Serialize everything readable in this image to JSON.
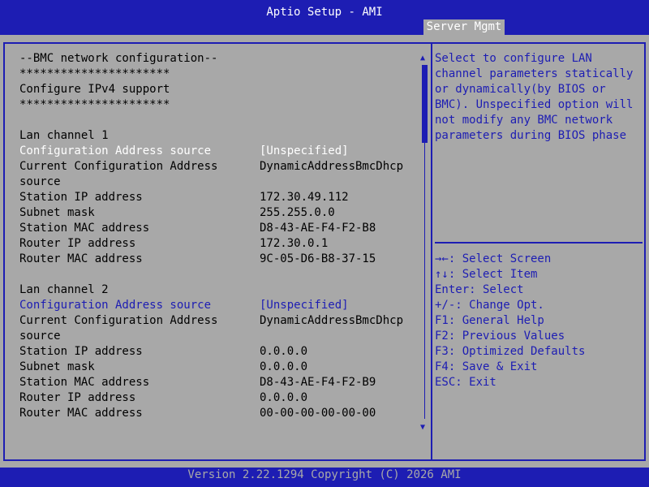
{
  "header": {
    "title": "Aptio Setup - AMI",
    "tab": "Server Mgmt"
  },
  "main": {
    "lines": [
      "--BMC network configuration--",
      "**********************",
      "Configure IPv4 support",
      "**********************",
      "Lan channel 1"
    ],
    "ch1": {
      "config_label": "Configuration Address source",
      "config_value": "[Unspecified]",
      "current_label_1": "Current Configuration Address",
      "current_label_2": "source",
      "current_value": "DynamicAddressBmcDhcp",
      "station_ip_label": "Station IP address",
      "station_ip_value": "172.30.49.112",
      "subnet_label": "Subnet mask",
      "subnet_value": "255.255.0.0",
      "station_mac_label": "Station MAC address",
      "station_mac_value": "D8-43-AE-F4-F2-B8",
      "router_ip_label": "Router IP address",
      "router_ip_value": "172.30.0.1",
      "router_mac_label": "Router MAC address",
      "router_mac_value": "9C-05-D6-B8-37-15"
    },
    "ch2_title": "Lan channel 2",
    "ch2": {
      "config_label": "Configuration Address source",
      "config_value": "[Unspecified]",
      "current_label_1": "Current Configuration Address",
      "current_label_2": "source",
      "current_value": "DynamicAddressBmcDhcp",
      "station_ip_label": "Station IP address",
      "station_ip_value": "0.0.0.0",
      "subnet_label": "Subnet mask",
      "subnet_value": "0.0.0.0",
      "station_mac_label": "Station MAC address",
      "station_mac_value": "D8-43-AE-F4-F2-B9",
      "router_ip_label": "Router IP address",
      "router_ip_value": "0.0.0.0",
      "router_mac_label": "Router MAC address",
      "router_mac_value": "00-00-00-00-00-00"
    }
  },
  "help": {
    "description": [
      "Select to configure LAN",
      "channel parameters statically",
      "or dynamically(by BIOS or",
      "BMC). Unspecified option will",
      "not modify any BMC network",
      "parameters during BIOS phase"
    ],
    "keys": [
      "→←: Select Screen",
      "↑↓: Select Item",
      "Enter: Select",
      "+/-: Change Opt.",
      "F1: General Help",
      "F2: Previous Values",
      "F3: Optimized Defaults",
      "F4: Save & Exit",
      "ESC: Exit"
    ]
  },
  "scroll": {
    "up_icon": "▲",
    "down_icon": "▼"
  },
  "footer": {
    "text": "Version 2.22.1294 Copyright (C) 2026 AMI"
  },
  "colors": {
    "background": "#a8a8a8",
    "accent": "#1d1db3",
    "selected_text": "#ffffff"
  }
}
